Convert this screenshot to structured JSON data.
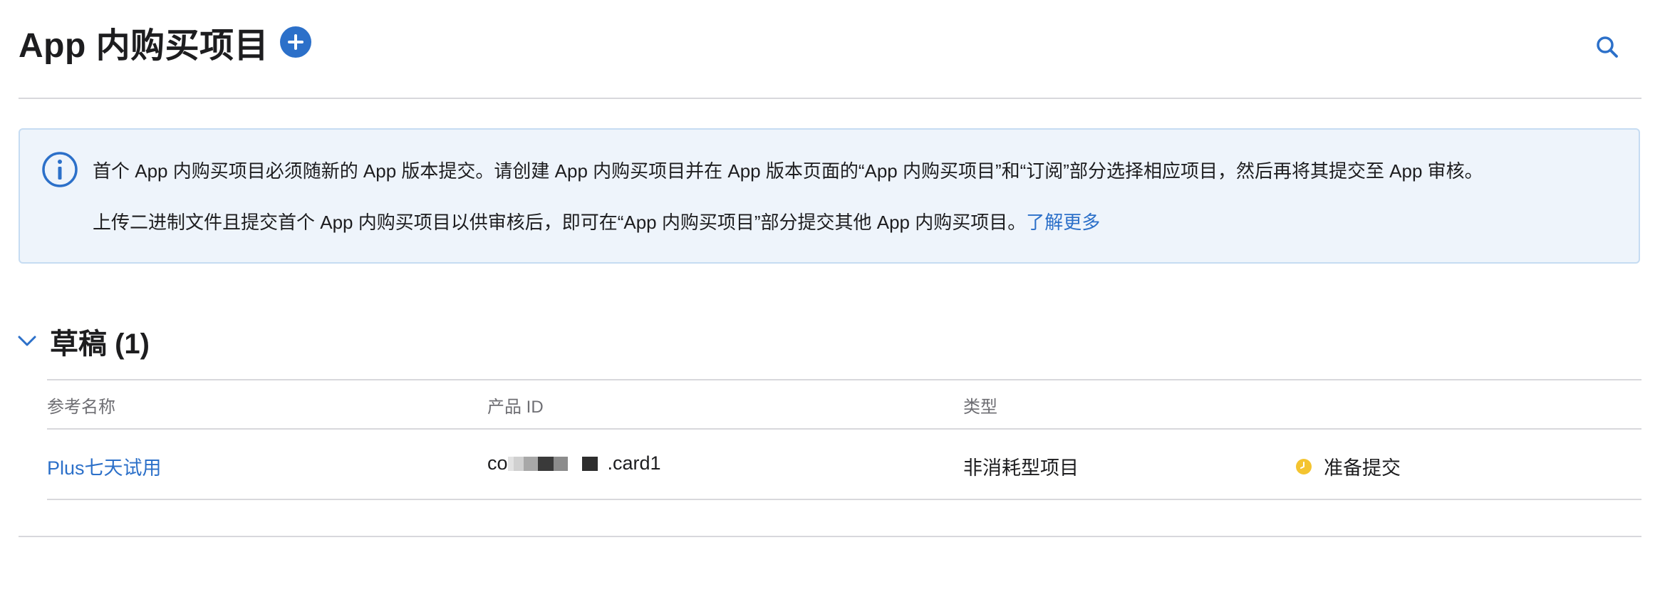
{
  "header": {
    "title": "App 内购买项目",
    "add_icon": "plus-circle-icon",
    "search_icon": "search-icon"
  },
  "info": {
    "icon": "info-circle-icon",
    "line1": "首个 App 内购买项目必须随新的 App 版本提交。请创建 App 内购买项目并在 App 版本页面的“App 内购买项目”和“订阅”部分选择相应项目，然后再将其提交至 App 审核。",
    "line2": "上传二进制文件且提交首个 App 内购买项目以供审核后，即可在“App 内购买项目”部分提交其他 App 内购买项目。",
    "learn_more": "了解更多"
  },
  "section": {
    "chevron_icon": "chevron-down-icon",
    "title": "草稿 (1)"
  },
  "table": {
    "columns": [
      "参考名称",
      "产品 ID",
      "类型"
    ],
    "rows": [
      {
        "name": "Plus七天试用",
        "product_id_prefix": "co",
        "product_id_suffix": ".card1",
        "type": "非消耗型项目",
        "status": "准备提交",
        "status_icon": "clock-icon"
      }
    ]
  },
  "colors": {
    "accent": "#2c70c9",
    "status_pending": "#f4c430",
    "info_bg": "#eef4fb"
  }
}
